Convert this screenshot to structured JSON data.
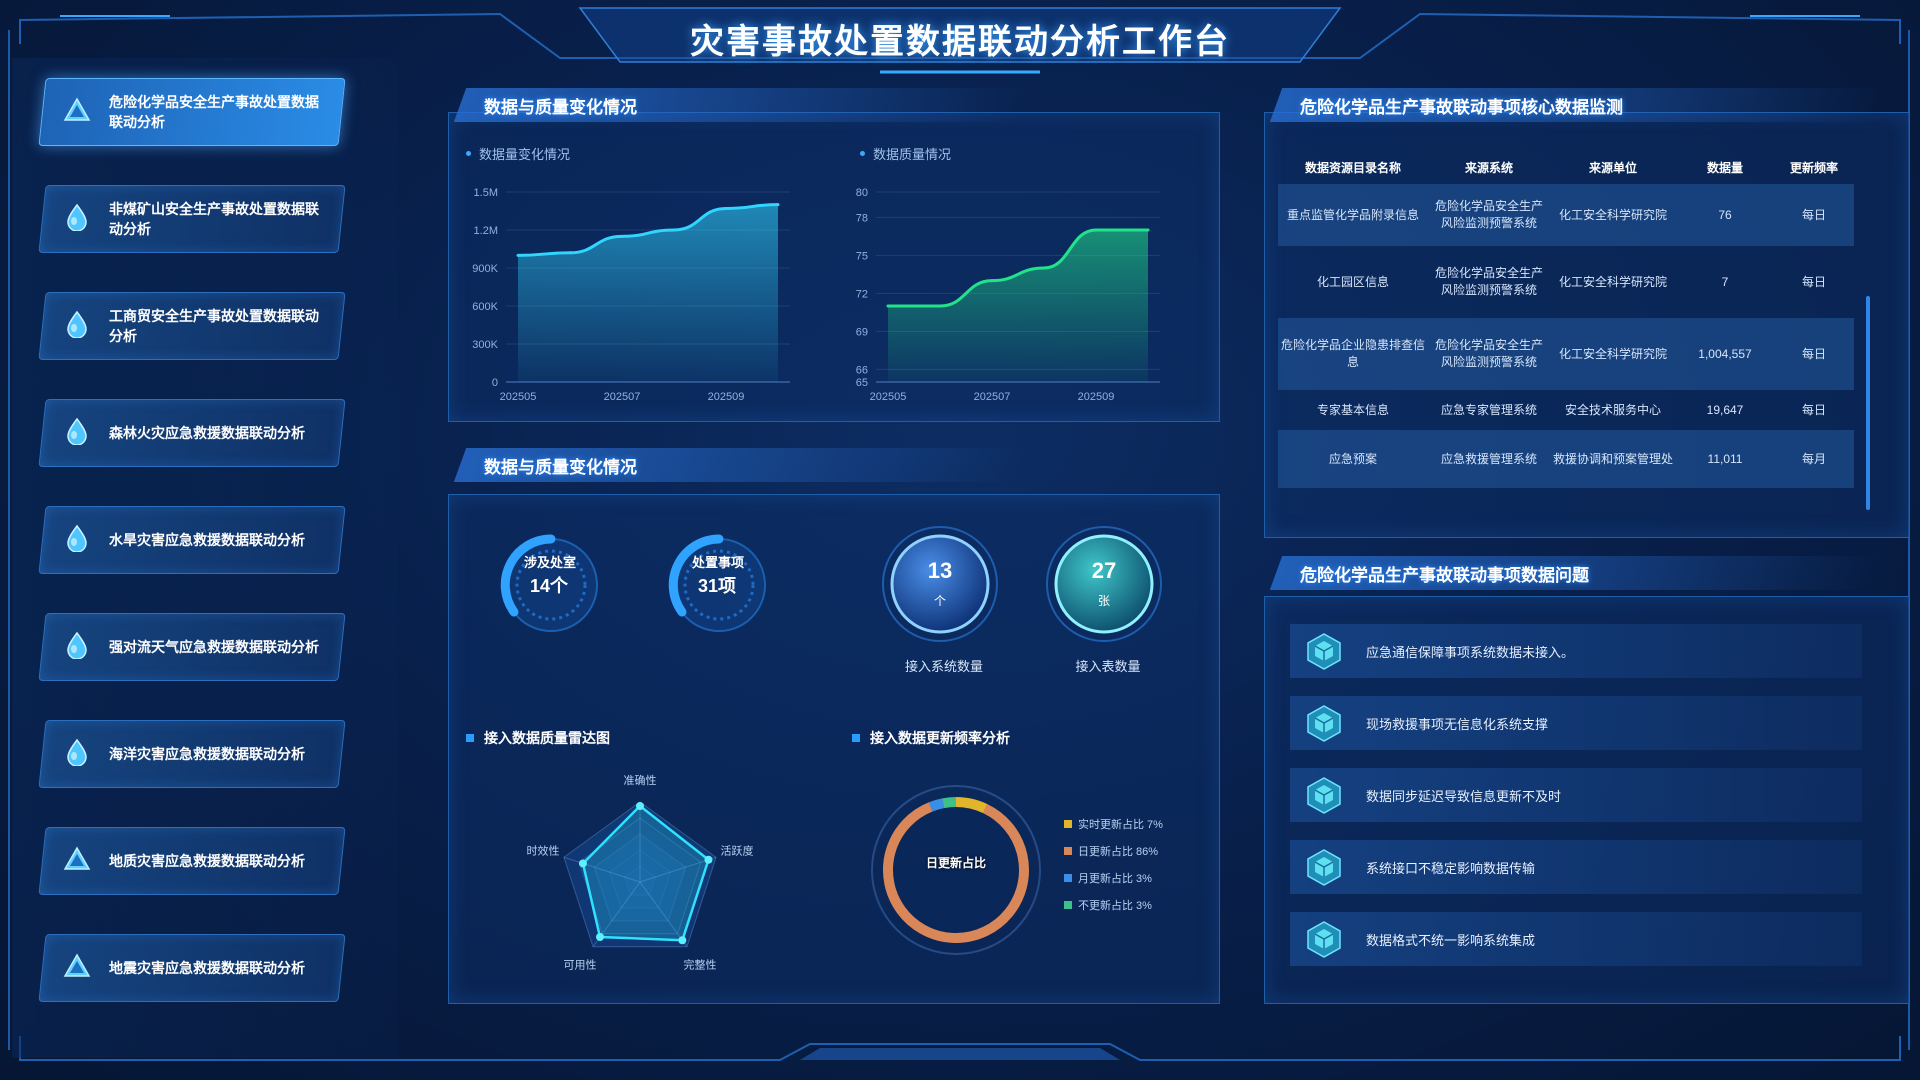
{
  "title": "灾害事故处置数据联动分析工作台",
  "colors": {
    "accent": "#2a9cff",
    "green": "#22e38a",
    "cyan": "#31d6ff"
  },
  "sidebar": {
    "items": [
      {
        "label": "危险化学品安全生产事故处置数据联动分析",
        "icon": "warning-triangle-icon",
        "active": true
      },
      {
        "label": "非煤矿山安全生产事故处置数据联动分析",
        "icon": "water-drop-icon"
      },
      {
        "label": "工商贸安全生产事故处置数据联动分析",
        "icon": "water-drop-icon"
      },
      {
        "label": "森林火灾应急救援数据联动分析",
        "icon": "water-drop-icon"
      },
      {
        "label": "水旱灾害应急救援数据联动分析",
        "icon": "water-drop-icon"
      },
      {
        "label": "强对流天气应急救援数据联动分析",
        "icon": "water-drop-icon"
      },
      {
        "label": "海洋灾害应急救援数据联动分析",
        "icon": "water-drop-icon"
      },
      {
        "label": "地质灾害应急救援数据联动分析",
        "icon": "warning-triangle-icon"
      },
      {
        "label": "地震灾害应急救援数据联动分析",
        "icon": "warning-triangle-icon"
      }
    ]
  },
  "panel1": {
    "title": "数据与质量变化情况",
    "chart1_title": "数据量变化情况",
    "chart2_title": "数据质量情况"
  },
  "panel2": {
    "title": "数据与质量变化情况",
    "stats": [
      {
        "label": "涉及处室",
        "value": "14个"
      },
      {
        "label": "处置事项",
        "value": "31项"
      }
    ],
    "circles": [
      {
        "value": "13",
        "unit": "个",
        "caption": "接入系统数量"
      },
      {
        "value": "27",
        "unit": "张",
        "caption": "接入表数量"
      }
    ],
    "radar_title": "接入数据质量雷达图",
    "donut_title": "接入数据更新频率分析",
    "donut_center": "日更新占比"
  },
  "panel3": {
    "title": "危险化学品生产事故联动事项核心数据监测",
    "headers": [
      "数据资源目录名称",
      "来源系统",
      "来源单位",
      "数据量",
      "更新频率"
    ],
    "rows": [
      [
        "重点监管化学品附录信息",
        "危险化学品安全生产风险监测预警系统",
        "化工安全科学研究院",
        "76",
        "每日"
      ],
      [
        "化工园区信息",
        "危险化学品安全生产风险监测预警系统",
        "化工安全科学研究院",
        "7",
        "每日"
      ],
      [
        "危险化学品企业隐患排查信息",
        "危险化学品安全生产风险监测预警系统",
        "化工安全科学研究院",
        "1,004,557",
        "每日"
      ],
      [
        "专家基本信息",
        "应急专家管理系统",
        "安全技术服务中心",
        "19,647",
        "每日"
      ],
      [
        "应急预案",
        "应急救援管理系统",
        "救援协调和预案管理处",
        "11,011",
        "每月"
      ]
    ]
  },
  "panel4": {
    "title": "危险化学品生产事故联动事项数据问题",
    "issues": [
      "应急通信保障事项系统数据未接入。",
      "现场救援事项无信息化系统支撑",
      "数据同步延迟导致信息更新不及时",
      "系统接口不稳定影响数据传输",
      "数据格式不统一影响系统集成"
    ]
  },
  "chart_data": [
    {
      "type": "area",
      "title": "数据量变化情况",
      "x": [
        "202505",
        "202506",
        "202507",
        "202508",
        "202509",
        "202510"
      ],
      "x_ticks": [
        "202505",
        "202507",
        "202509"
      ],
      "values": [
        1000000,
        1020000,
        1150000,
        1200000,
        1370000,
        1400000
      ],
      "y_ticks": [
        "0",
        "300K",
        "600K",
        "900K",
        "1.2M",
        "1.5M"
      ],
      "ylim": [
        0,
        1500000
      ]
    },
    {
      "type": "area",
      "title": "数据质量情况",
      "x": [
        "202505",
        "202506",
        "202507",
        "202508",
        "202509",
        "202510"
      ],
      "x_ticks": [
        "202505",
        "202507",
        "202509"
      ],
      "values": [
        71,
        71,
        73,
        74,
        77,
        77
      ],
      "y_ticks": [
        "65",
        "66",
        "69",
        "72",
        "75",
        "78",
        "80"
      ],
      "ylim": [
        65,
        80
      ]
    },
    {
      "type": "radar",
      "title": "接入数据质量雷达图",
      "axes": [
        "准确性",
        "活跃度",
        "完整性",
        "可用性",
        "时效性"
      ],
      "values": [
        0.95,
        0.9,
        0.9,
        0.85,
        0.75
      ],
      "max": 1
    },
    {
      "type": "pie",
      "title": "接入数据更新频率分析",
      "slices": [
        {
          "label": "实时更新占比 7%",
          "value": 7,
          "color": "#e0b52c"
        },
        {
          "label": "日更新占比 86%",
          "value": 86,
          "color": "#d98758"
        },
        {
          "label": "月更新占比 3%",
          "value": 3,
          "color": "#3a8ee6"
        },
        {
          "label": "不更新占比 3%",
          "value": 3,
          "color": "#3fc08a"
        }
      ]
    }
  ]
}
